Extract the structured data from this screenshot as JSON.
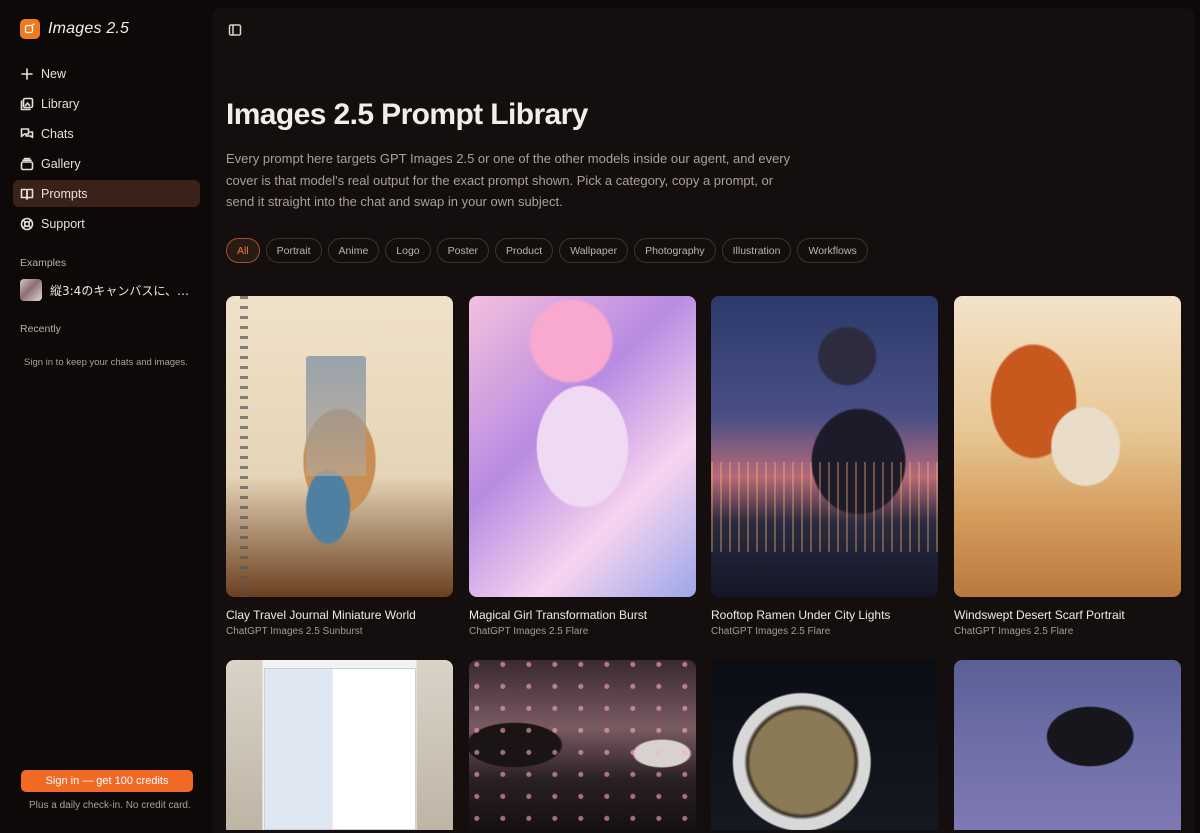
{
  "brand": {
    "title": "Images 2.5",
    "accent": "#f07a22"
  },
  "nav": [
    {
      "label": "New",
      "icon": "plus-icon"
    },
    {
      "label": "Library",
      "icon": "library-icon"
    },
    {
      "label": "Chats",
      "icon": "chats-icon"
    },
    {
      "label": "Gallery",
      "icon": "gallery-icon"
    },
    {
      "label": "Prompts",
      "icon": "book-icon",
      "active": true
    },
    {
      "label": "Support",
      "icon": "lifebuoy-icon"
    }
  ],
  "sections": {
    "examples_label": "Examples",
    "example_item": "縦3:4のキャンバスに、同...",
    "recently_label": "Recently",
    "recently_note": "Sign in to keep your chats and images."
  },
  "footer": {
    "signin_label": "Sign in — get 100 credits",
    "checkin_note": "Plus a daily check-in. No credit card."
  },
  "page": {
    "title": "Images 2.5 Prompt Library",
    "description": "Every prompt here targets GPT Images 2.5 or one of the other models inside our agent, and every cover is that model's real output for the exact prompt shown. Pick a category, copy a prompt, or send it straight into the chat and swap in your own subject."
  },
  "filters": [
    "All",
    "Portrait",
    "Anime",
    "Logo",
    "Poster",
    "Product",
    "Wallpaper",
    "Photography",
    "Illustration",
    "Workflows"
  ],
  "active_filter": "All",
  "cards": [
    {
      "title": "Clay Travel Journal Miniature World",
      "model": "ChatGPT Images 2.5 Sunburst"
    },
    {
      "title": "Magical Girl Transformation Burst",
      "model": "ChatGPT Images 2.5 Flare"
    },
    {
      "title": "Rooftop Ramen Under City Lights",
      "model": "ChatGPT Images 2.5 Flare"
    },
    {
      "title": "Windswept Desert Scarf Portrait",
      "model": "ChatGPT Images 2.5 Flare"
    }
  ],
  "colors": {
    "cta": "#f06a26",
    "active_nav_bg": "#3a2218",
    "active_chip": "#f07a3c"
  }
}
